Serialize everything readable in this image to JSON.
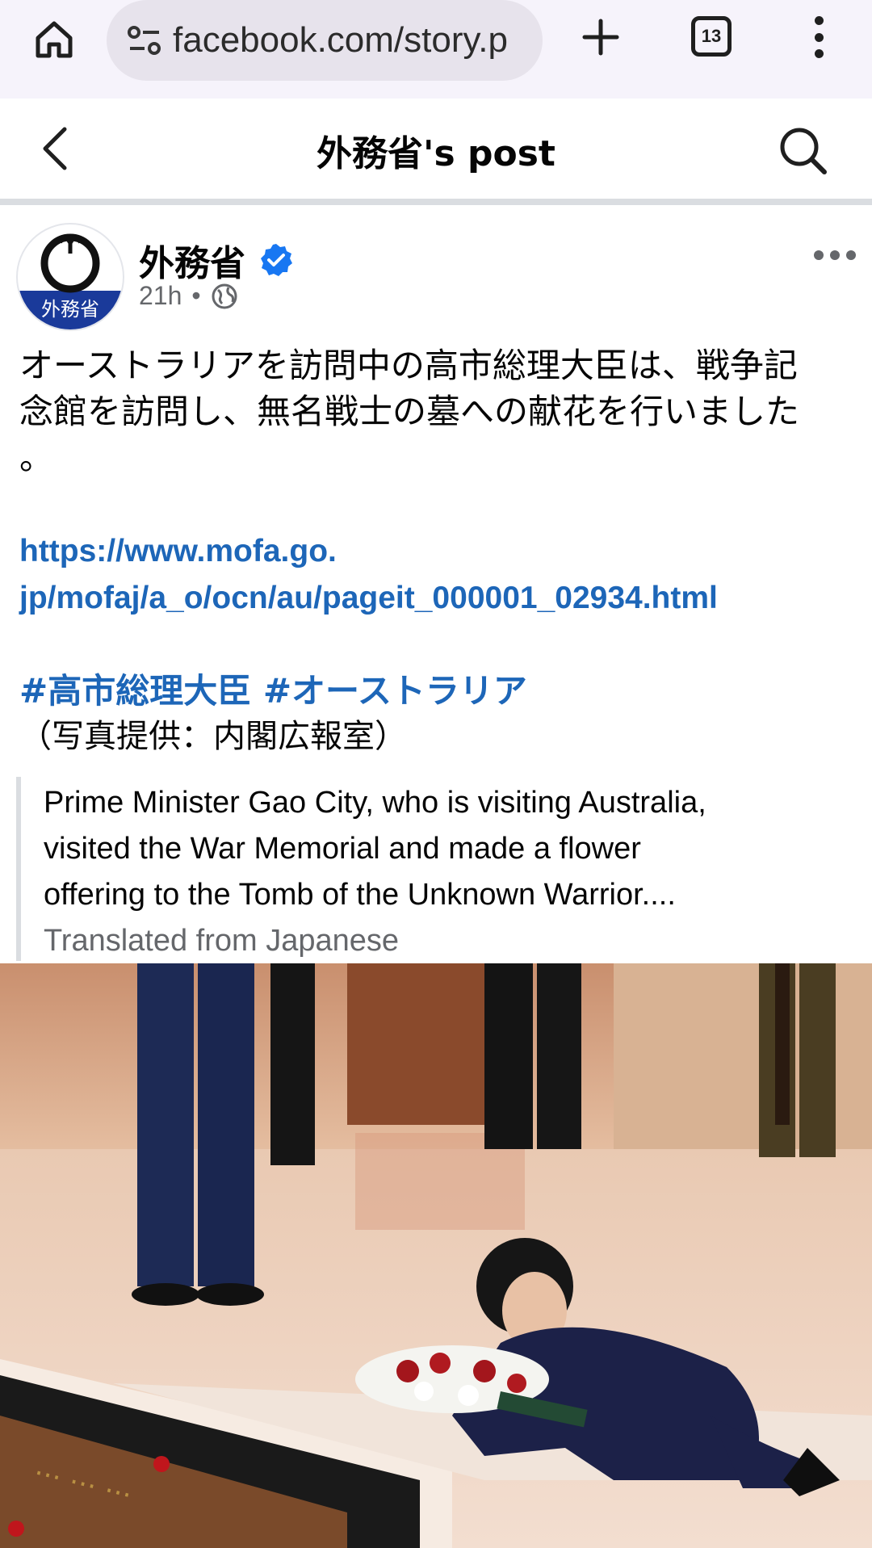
{
  "browser": {
    "url": "facebook.com/story.p",
    "tab_count": "13"
  },
  "header": {
    "title": "外務省's post"
  },
  "post": {
    "author": "外務省",
    "avatar_text": "外務省",
    "time": "21h",
    "separator": "•",
    "body_lines": [
      "オーストラリアを訪問中の高市総理大臣は、戦争記",
      "念館を訪問し、無名戦士の墓への献花を行いました",
      "。"
    ],
    "link_lines": [
      "https://www.mofa.go.",
      "jp/mofaj/a_o/ocn/au/pageit_000001_02934.html"
    ],
    "hashtags": "#高市総理大臣 #オーストラリア",
    "photo_credit": "（写真提供：内閣広報室）",
    "translation": {
      "lines": [
        "Prime Minister Gao City, who is visiting Australia,",
        "visited the War Memorial and made a flower",
        "offering to the Tomb of the Unknown Warrior...."
      ],
      "note": "Translated from Japanese"
    }
  },
  "colors": {
    "link": "#1d66b8",
    "verified": "#1877f2",
    "secondary_text": "#65676b",
    "avatar_band": "#1a3a9a"
  },
  "icons": {
    "home": "home-icon",
    "site_settings": "tune-icon",
    "new_tab": "plus-icon",
    "tab_switcher": "tab-count-icon",
    "menu": "kebab-menu-icon",
    "back": "chevron-left-icon",
    "search": "search-icon",
    "verified": "verified-badge-icon",
    "audience": "globe-icon",
    "more": "more-horizontal-icon"
  }
}
